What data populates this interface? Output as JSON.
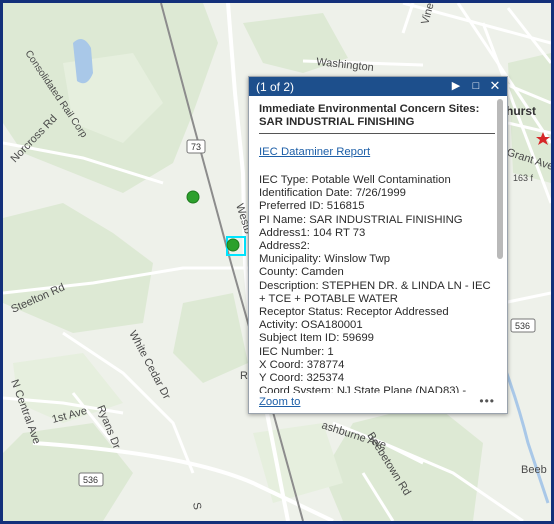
{
  "map": {
    "labels": {
      "washington": "Washington",
      "vine": "Vine",
      "grant_ave": "Grant Ave",
      "hurst": "hurst",
      "consolidated": "Consolidated Rail Corp",
      "norcross": "Norcross Rd",
      "westbrook": "Westb",
      "steelton": "Steelton Rd",
      "white_cedar": "White Cedar Dr",
      "central_ave": "N Central Ave",
      "first_ave": "1st Ave",
      "ryans": "Ryans Dr",
      "ashburne": "ashburne Ave",
      "beebetown": "Beebetown Rd",
      "beeb": "Beeb",
      "s_road": "S",
      "num_163": "163 f",
      "r_letter": "R"
    },
    "shields": {
      "route73": "73",
      "route536a": "536",
      "route536b": "536"
    },
    "colors": {
      "popup_header": "#1d4f8c",
      "point_fill": "#2ca02c",
      "link": "#1d5fa8",
      "frame": "#13307a",
      "star": "#d62728"
    }
  },
  "popup": {
    "pager": "(1 of 2)",
    "title": "Immediate Environmental Concern Sites: SAR INDUSTRIAL FINISHING",
    "link": "IEC Dataminer Report",
    "fields": [
      "IEC Type: Potable Well Contamination",
      "Identification Date: 7/26/1999",
      "Preferred ID: 516815",
      "PI Name: SAR INDUSTRIAL FINISHING",
      "Address1: 104 RT 73",
      "Address2:",
      "Municipality: Winslow Twp",
      "County: Camden",
      "Description: STEPHEN DR. & LINDA LN - IEC + TCE + POTABLE WATER",
      "Receptor Status: Receptor Addressed",
      "Activity: OSA180001",
      "Subject Item ID: 59699",
      "IEC Number: 1",
      "X Coord: 378774",
      "Y Coord: 325374",
      "Coord System: NJ State Plane (NAD83) -"
    ],
    "zoom": "Zoom to",
    "more": "•••"
  }
}
